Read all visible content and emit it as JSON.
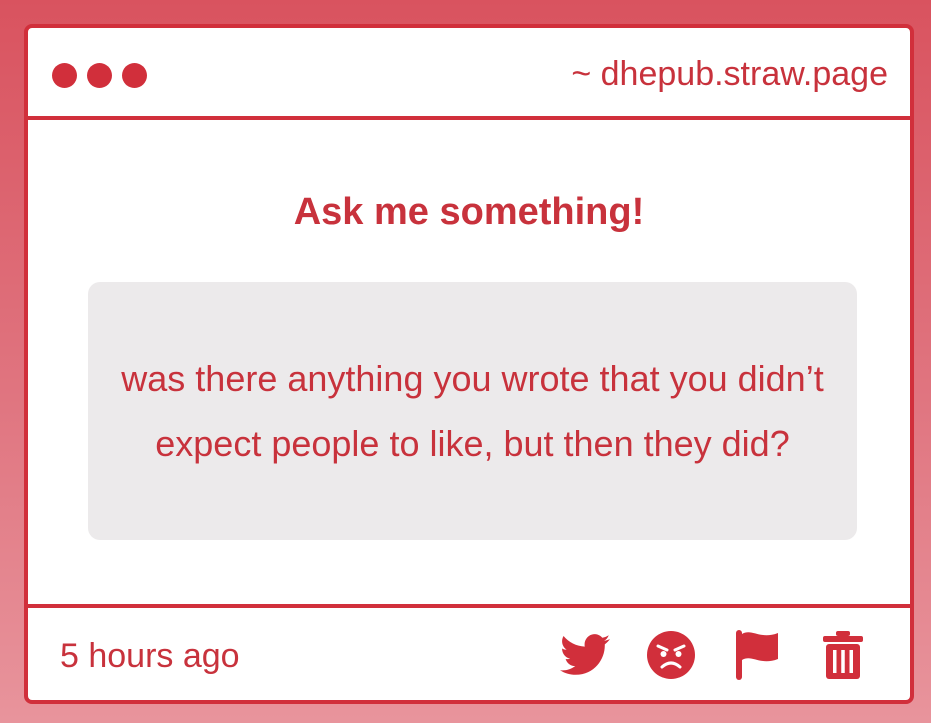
{
  "window": {
    "url_label": "~ dhepub.straw.page"
  },
  "main": {
    "title": "Ask me something!",
    "question": "was there anything you wrote that you didn’t expect people to like, but then they did?"
  },
  "footer": {
    "timestamp": "5 hours ago",
    "actions": [
      {
        "icon": "twitter-icon"
      },
      {
        "icon": "angry-face-icon"
      },
      {
        "icon": "flag-icon"
      },
      {
        "icon": "trash-icon"
      }
    ]
  },
  "colors": {
    "accent": "#d12f3b",
    "text": "#c8323c",
    "question_bg": "#eceaeb",
    "page_bg_top": "#d9535f",
    "page_bg_bottom": "#e8949c"
  }
}
